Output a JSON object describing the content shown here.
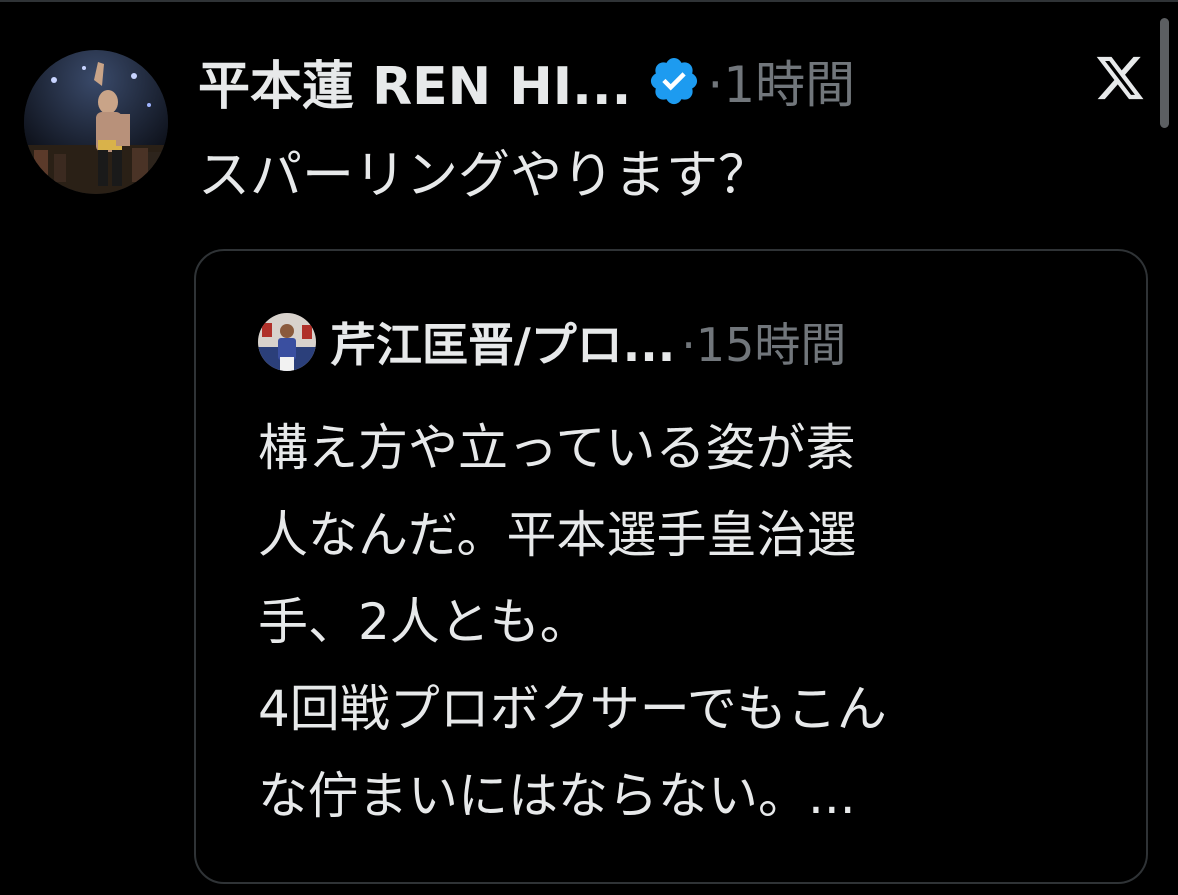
{
  "tweet": {
    "display_name": "平本蓮 REN HI...",
    "time": "·1時間",
    "text": "スパーリングやります？",
    "verified_icon": "verified-badge-icon",
    "brand_icon": "x-logo-icon"
  },
  "quote": {
    "display_name": "芹江匡晋/プロ...",
    "time": "·15時間",
    "lines": [
      "構え方や立っている姿が素",
      "人なんだ。平本選手皇治選",
      "手、2人とも。",
      "4回戦プロボクサーでもこん",
      "な佇まいにはならない。..."
    ]
  },
  "colors": {
    "background": "#000000",
    "text_primary": "#e7e9ea",
    "text_secondary": "#71767b",
    "verified_blue": "#1d9bf0",
    "border": "#2f3336"
  }
}
